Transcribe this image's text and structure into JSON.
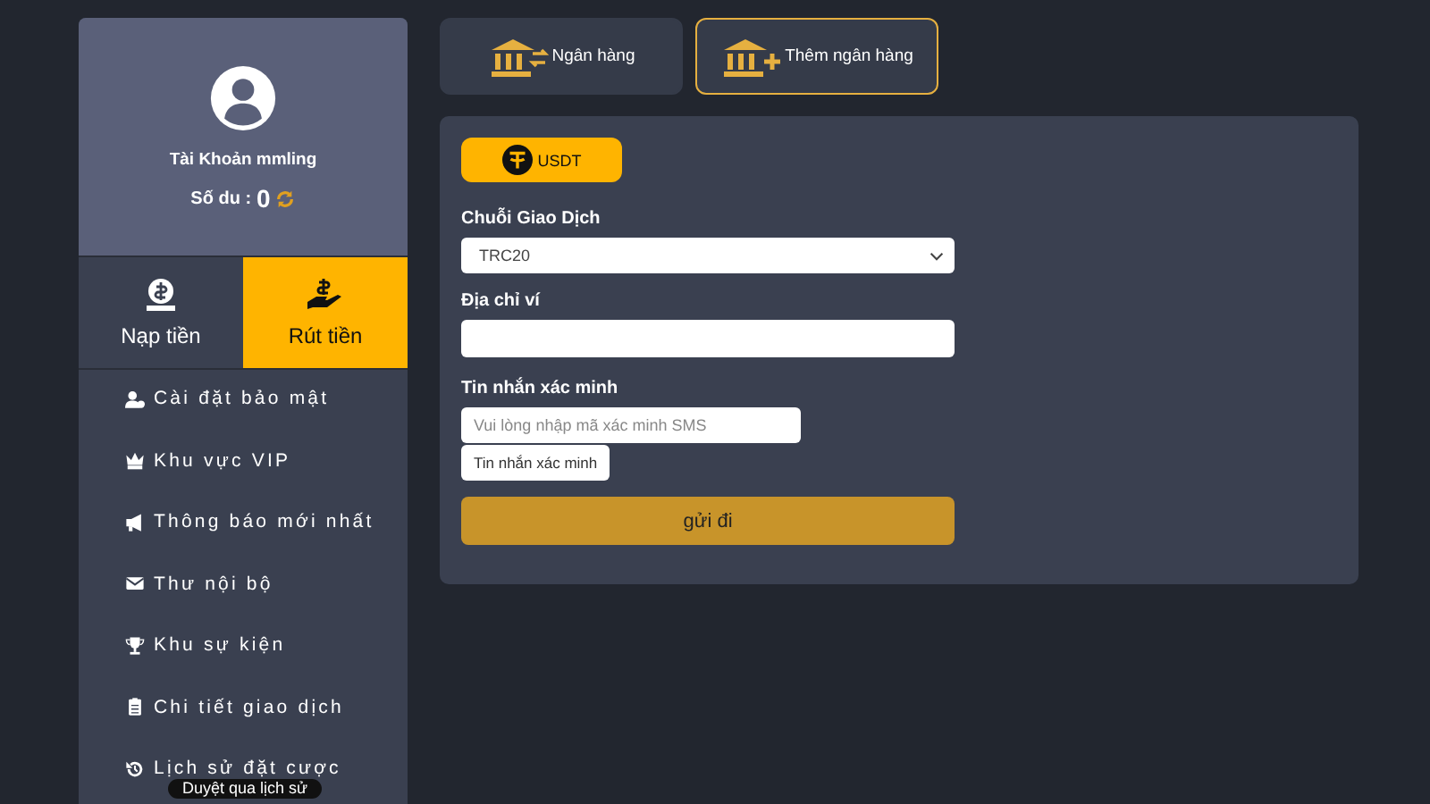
{
  "profile": {
    "account": "Tài Khoản mmling",
    "balance_label": "Số du :",
    "balance": "0"
  },
  "actions": [
    {
      "label": "Nạp tiền",
      "kind": "deposit",
      "selected": false
    },
    {
      "label": "Rút tiền",
      "kind": "withdraw",
      "selected": true
    }
  ],
  "menu": [
    {
      "label": "Cài đặt bảo mật",
      "kind": "security"
    },
    {
      "label": "Khu vực VIP",
      "kind": "vip"
    },
    {
      "label": "Thông báo mới nhất",
      "kind": "announce"
    },
    {
      "label": "Thư nội bộ",
      "kind": "mail"
    },
    {
      "label": "Khu sự kiện",
      "kind": "trophy"
    },
    {
      "label": "Chi tiết giao dịch",
      "kind": "clipboard"
    },
    {
      "label": "Lịch sử đặt cược",
      "kind": "history"
    }
  ],
  "tooltip": "Duyệt qua lịch sử",
  "tabs": [
    {
      "label": "Ngân hàng",
      "kind": "bank",
      "selected": false
    },
    {
      "label": "Thêm ngân hàng",
      "kind": "add",
      "selected": true
    }
  ],
  "currency": {
    "label": "USDT"
  },
  "form": {
    "chain_label": "Chuỗi Giao Dịch",
    "chain_value": "TRC20",
    "address_label": "Địa chỉ ví",
    "sms_label": "Tin nhắn xác minh",
    "sms_placeholder": "Vui lòng nhập mã xác minh SMS",
    "sms_button": "Tin nhắn xác minh",
    "submit": "gửi đi"
  }
}
